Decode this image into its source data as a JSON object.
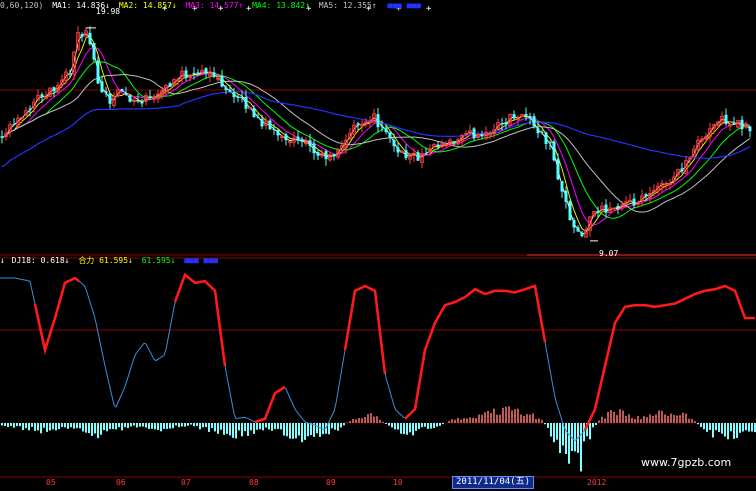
{
  "colors": {
    "up": "#ff3b3b",
    "down": "#55ffff",
    "ma1": "#ffffff",
    "ma2": "#ffff00",
    "ma3": "#ff00ff",
    "ma4": "#00ff00",
    "ma5": "#c0c0c0",
    "ma6": "#2233ff",
    "osc_blue": "#3a8fd8",
    "osc_red": "#ff1a1a",
    "divider": "#8a0000"
  },
  "price_legend": {
    "params": "0,60,120)",
    "items": [
      {
        "label": "MA1:",
        "value": "14.836↓"
      },
      {
        "label": "MA2:",
        "value": "14.857↓"
      },
      {
        "label": "MA3:",
        "value": "14.577↑"
      },
      {
        "label": "MA4:",
        "value": "13.842↑"
      },
      {
        "label": "MA5:",
        "value": "12.355↑"
      }
    ]
  },
  "indicator_legend": {
    "items": [
      {
        "label": "DJ18:",
        "value": "0.618↓"
      },
      {
        "label": "合力",
        "value": "61.595↓"
      },
      {
        "label": "",
        "value": "61.595↓"
      }
    ]
  },
  "annotations": {
    "high": "19.98",
    "low": "9.07"
  },
  "x_axis": {
    "ticks": [
      {
        "label": "05",
        "x": 50
      },
      {
        "label": "06",
        "x": 120
      },
      {
        "label": "07",
        "x": 185
      },
      {
        "label": "08",
        "x": 253
      },
      {
        "label": "09",
        "x": 330
      },
      {
        "label": "10",
        "x": 397
      },
      {
        "label": "2012",
        "x": 595
      }
    ],
    "cursor_date": "2011/11/04(五)"
  },
  "watermark": "www.7gpzb.com",
  "chart_data": {
    "type": "line",
    "title": "",
    "price_panel": {
      "ylim": [
        8.5,
        21.0
      ],
      "high_marker": 19.98,
      "low_marker": 9.07,
      "moving_averages": [
        {
          "name": "MA1",
          "last": 14.836
        },
        {
          "name": "MA2",
          "last": 14.857
        },
        {
          "name": "MA3",
          "last": 14.577
        },
        {
          "name": "MA4",
          "last": 13.842
        },
        {
          "name": "MA5",
          "last": 12.355
        }
      ],
      "close_path": {
        "x": [
          0,
          20,
          40,
          55,
          70,
          78,
          85,
          92,
          100,
          110,
          120,
          135,
          150,
          165,
          180,
          195,
          210,
          220,
          235,
          250,
          265,
          275,
          290,
          305,
          320,
          335,
          345,
          360,
          375,
          385,
          395,
          405,
          420,
          435,
          450,
          465,
          480,
          495,
          510,
          520,
          530,
          540,
          550,
          560,
          570,
          580,
          590,
          600,
          615,
          630,
          645,
          660,
          675,
          690,
          705,
          715,
          725,
          735,
          745
        ],
        "y": [
          14.5,
          15.5,
          16.5,
          17.0,
          17.8,
          19.5,
          19.9,
          18.5,
          17.0,
          16.3,
          16.8,
          16.2,
          16.5,
          17.0,
          17.5,
          17.8,
          17.6,
          17.3,
          16.5,
          15.8,
          15.0,
          14.7,
          14.3,
          13.9,
          13.4,
          13.3,
          14.3,
          15.2,
          15.4,
          14.5,
          13.9,
          13.5,
          13.3,
          13.8,
          14.0,
          14.4,
          14.6,
          14.8,
          15.4,
          15.6,
          15.3,
          14.6,
          13.9,
          12.0,
          10.2,
          9.1,
          10.1,
          10.7,
          10.8,
          10.9,
          11.2,
          11.8,
          12.4,
          13.4,
          14.6,
          15.1,
          15.3,
          15.1,
          14.8
        ]
      }
    },
    "indicator_panel": {
      "ylim": [
        -20,
        110
      ],
      "x": [
        0,
        15,
        30,
        45,
        55,
        65,
        75,
        85,
        95,
        105,
        115,
        125,
        135,
        145,
        155,
        165,
        175,
        185,
        195,
        205,
        215,
        225,
        235,
        245,
        255,
        265,
        275,
        285,
        295,
        305,
        315,
        325,
        335,
        345,
        355,
        365,
        375,
        385,
        395,
        405,
        415,
        425,
        435,
        445,
        455,
        465,
        475,
        485,
        495,
        505,
        515,
        525,
        535,
        545,
        555,
        565,
        575,
        585,
        595,
        605,
        615,
        625,
        635,
        645,
        655,
        665,
        675,
        685,
        695,
        705,
        715,
        725,
        735,
        745
      ],
      "values": [
        100,
        100,
        98,
        55,
        75,
        97,
        100,
        95,
        75,
        45,
        18,
        32,
        52,
        60,
        48,
        52,
        85,
        102,
        97,
        98,
        92,
        45,
        12,
        13,
        10,
        12,
        28,
        32,
        18,
        10,
        8,
        5,
        18,
        55,
        92,
        95,
        92,
        40,
        18,
        12,
        18,
        55,
        72,
        83,
        85,
        88,
        93,
        90,
        92,
        92,
        91,
        93,
        95,
        60,
        25,
        5,
        -2,
        5,
        18,
        45,
        72,
        82,
        83,
        83,
        82,
        83,
        84,
        87,
        90,
        92,
        93,
        95,
        92,
        75
      ],
      "red_segments": [
        [
          35,
          80
        ],
        [
          175,
          225
        ],
        [
          255,
          285
        ],
        [
          345,
          385
        ],
        [
          405,
          545
        ],
        [
          585,
          755
        ]
      ]
    },
    "volume_panel": {
      "x": [
        0,
        10,
        20,
        30,
        40,
        50,
        60,
        70,
        80,
        90,
        100,
        110,
        120,
        130,
        140,
        150,
        160,
        170,
        180,
        190,
        200,
        210,
        220,
        230,
        240,
        250,
        260,
        270,
        280,
        290,
        300,
        310,
        320,
        330,
        340,
        350,
        360,
        370,
        380,
        390,
        400,
        410,
        420,
        430,
        440,
        450,
        460,
        470,
        480,
        490,
        500,
        510,
        520,
        530,
        540,
        550,
        560,
        570,
        580,
        590,
        600,
        610,
        620,
        630,
        640,
        650,
        660,
        670,
        680,
        690,
        700,
        710,
        720,
        730,
        740,
        750
      ],
      "values": [
        -2,
        -4,
        -5,
        -6,
        -8,
        -6,
        -5,
        -4,
        -7,
        -9,
        -12,
        -10,
        -6,
        -4,
        -3,
        -5,
        -6,
        -4,
        -3,
        -2,
        -5,
        -7,
        -10,
        -12,
        -11,
        -9,
        -6,
        -8,
        -10,
        -14,
        -18,
        -15,
        -12,
        -8,
        -5,
        4,
        6,
        8,
        3,
        -5,
        -8,
        -10,
        -6,
        -4,
        -3,
        3,
        4,
        6,
        8,
        10,
        12,
        14,
        10,
        8,
        4,
        -10,
        -25,
        -40,
        -35,
        -10,
        5,
        10,
        12,
        6,
        5,
        8,
        10,
        12,
        8,
        6,
        -4,
        -10,
        -12,
        -12,
        -12,
        -12
      ]
    }
  }
}
